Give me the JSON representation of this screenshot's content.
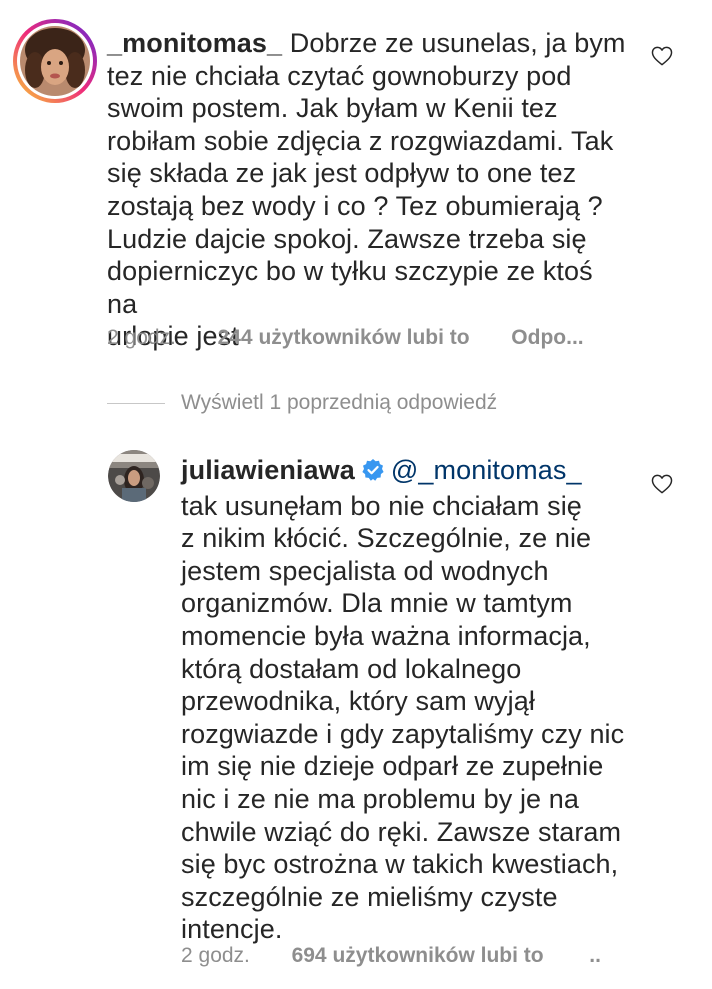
{
  "comments": [
    {
      "username": "_monitomas_",
      "verified": false,
      "lines": [
        "Dobrze ze usunelas, ja bym",
        "tez nie chciała czytać gownoburzy pod",
        "swoim postem. Jak byłam w Kenii tez",
        "robiłam sobie zdjęcia z rozgwiazdami. Tak",
        "się składa ze jak jest odpływ to one tez",
        "zostają bez wody i co ? Tez obumierają ?",
        "Ludzie dajcie spokoj. Zawsze trzeba się",
        "dopierniczyc bo w tyłku szczypie ze ktoś na",
        "urlopie jest"
      ],
      "time": "2 godz.",
      "likes": "244 użytkowników lubi to",
      "reply": "Odpo..."
    },
    {
      "username": "juliawieniawa",
      "verified": true,
      "mention": "@_monitomas_",
      "lines": [
        "tak usunęłam bo nie chciałam się",
        "z nikim kłócić. Szczególnie, ze nie",
        "jestem specjalista od wodnych",
        "organizmów. Dla mnie w tamtym",
        "momencie była ważna informacja,",
        "którą dostałam od lokalnego",
        "przewodnika, który sam wyjął",
        "rozgwiazde i gdy zapytaliśmy czy nic",
        "im się nie dzieje odparł ze zupełnie",
        "nic i ze nie ma problemu by je na",
        "chwile wziąć do ręki. Zawsze staram",
        "się byc ostrożna w takich kwestiach,",
        "szczególnie ze mieliśmy czyste",
        "intencje."
      ],
      "time": "2 godz.",
      "likes": "694 użytkowników lubi to",
      "reply": ".."
    }
  ],
  "view_replies": "Wyświetl 1 poprzednią odpowiedź",
  "icons": {
    "like": "heart-outline-icon",
    "verified": "verified-badge-icon"
  },
  "colors": {
    "text": "#262626",
    "secondary": "#8e8e8e",
    "mention": "#003569",
    "verified": "#3897f0"
  }
}
